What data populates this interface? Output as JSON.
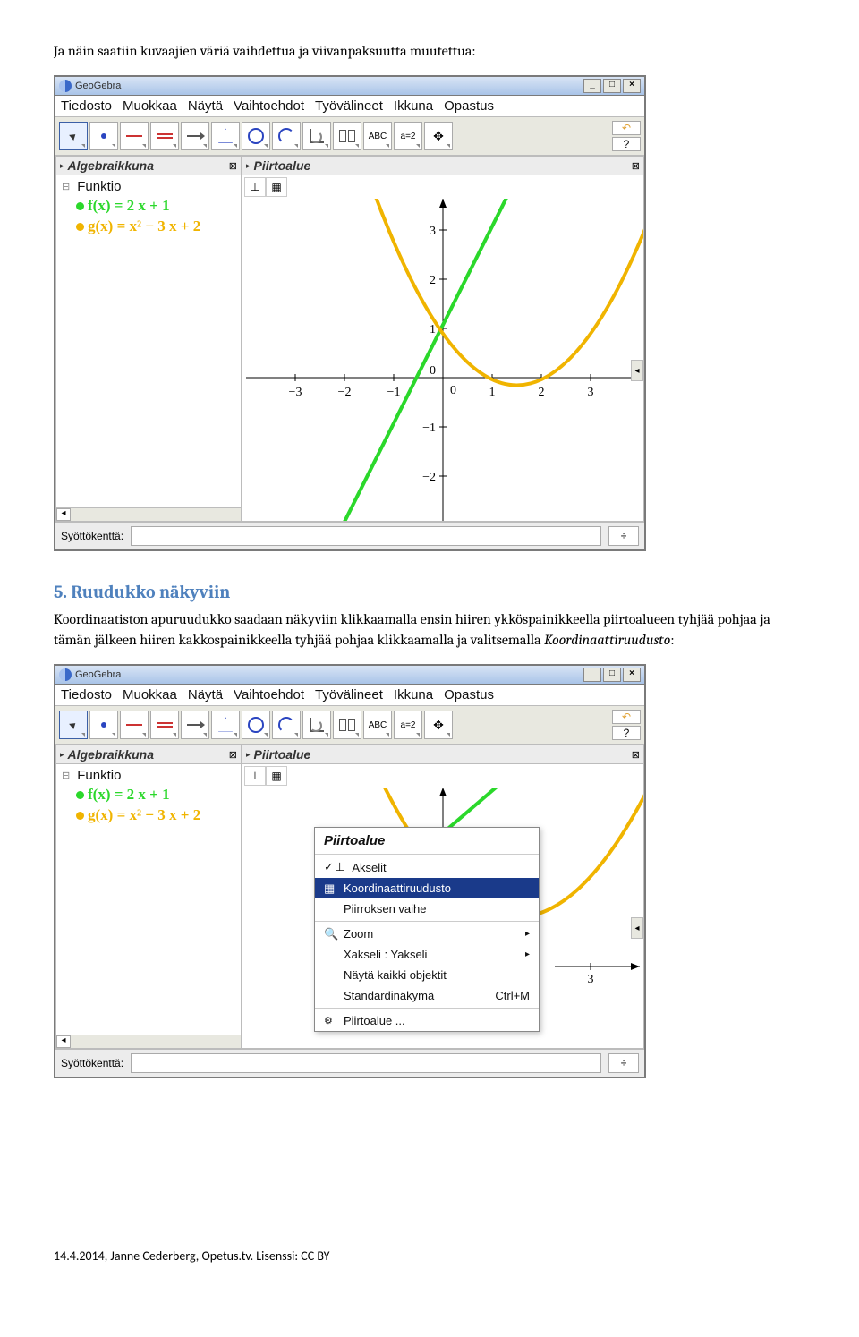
{
  "intro_text": "Ja näin saatiin kuvaajien väriä vaihdettua ja viivanpaksuutta muutettua:",
  "section_heading": "5. Ruudukko näkyviin",
  "section_body_a": "Koordinaatiston apuruudukko saadaan näkyviin klikkaamalla ensin hiiren ykköspainikkeella piirtoalueen tyhjää pohjaa ja tämän jälkeen hiiren kakkospainikkeella tyhjää pohjaa klikkaamalla ja valitsemalla ",
  "section_body_em": "Koordinaattiruudusto",
  "section_body_b": ":",
  "footer_text": "14.4.2014, Janne Cederberg, Opetus.tv. Lisenssi: CC BY",
  "app": {
    "title": "GeoGebra",
    "menus": [
      "Tiedosto",
      "Muokkaa",
      "Näytä",
      "Vaihtoehdot",
      "Työvälineet",
      "Ikkuna",
      "Opastus"
    ],
    "panels": {
      "algebra": "Algebraikkuna",
      "draw": "Piirtoalue"
    },
    "algebra_category": "Funktio",
    "functions": [
      {
        "name": "f(x) = 2 x + 1",
        "color": "#2bd82b"
      },
      {
        "name": "g(x) = x² − 3 x + 2",
        "color": "#f0b400"
      }
    ],
    "input_label": "Syöttökenttä:",
    "context_menu": {
      "title": "Piirtoalue",
      "items_top": [
        {
          "label": "Akselit",
          "icon": "axes"
        },
        {
          "label": "Koordinaattiruudusto",
          "icon": "grid",
          "selected": true
        },
        {
          "label": "Piirroksen vaihe"
        }
      ],
      "items_bottom": [
        {
          "label": "Zoom",
          "icon": "zoom",
          "submenu": true
        },
        {
          "label": "Xakseli : Yakseli",
          "submenu": true
        },
        {
          "label": "Näytä kaikki objektit"
        },
        {
          "label": "Standardinäkymä",
          "shortcut": "Ctrl+M"
        }
      ],
      "footer_item": "Piirtoalue ..."
    },
    "axis_tick_3": "3"
  },
  "chart_data": {
    "type": "line",
    "title": "",
    "xlabel": "",
    "ylabel": "",
    "xlim": [
      -3.5,
      3.8
    ],
    "ylim": [
      -2.7,
      3.7
    ],
    "x_ticks": [
      -3,
      -2,
      -1,
      0,
      1,
      2,
      3
    ],
    "y_ticks": [
      -2,
      -1,
      0,
      1,
      2,
      3
    ],
    "series": [
      {
        "name": "f(x)=2x+1",
        "color": "#2bd82b",
        "type": "line",
        "formula": "2*x+1"
      },
      {
        "name": "g(x)=x^2-3x+2",
        "color": "#f0b400",
        "type": "parabola",
        "formula": "x^2-3*x+2"
      }
    ]
  }
}
